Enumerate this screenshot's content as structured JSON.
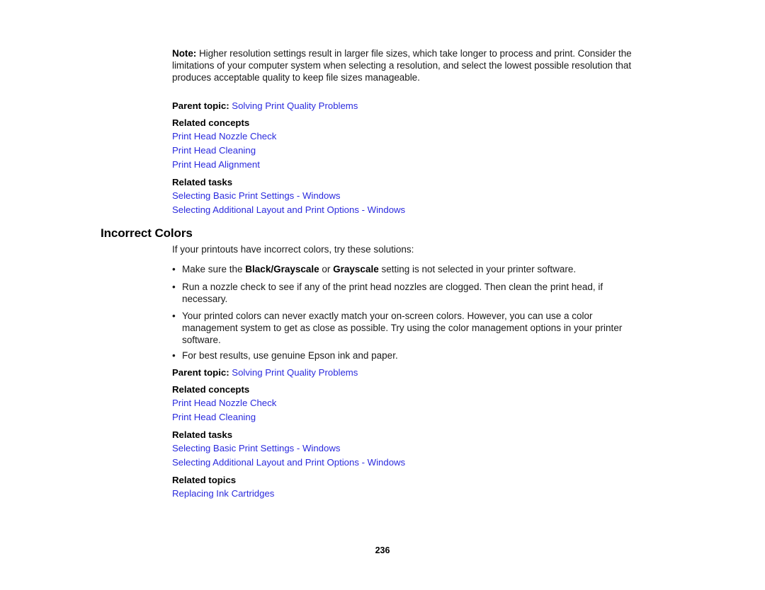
{
  "page": {
    "number": "236",
    "background": "#ffffff",
    "link_color": "#2b2bde",
    "text_color": "#1a1a1a"
  },
  "note": {
    "label": "Note:",
    "text": "Higher resolution settings result in larger file sizes, which take longer to process and print. Consider the limitations of your computer system when selecting a resolution, and select the lowest possible resolution that produces acceptable quality to keep file sizes manageable."
  },
  "related_block_top": {
    "parent_topic_label": "Parent topic:",
    "parent_topic_link": "Solving Print Quality Problems",
    "concepts_heading": "Related concepts",
    "concepts_links": [
      "Print Head Nozzle Check",
      "Print Head Cleaning",
      "Print Head Alignment"
    ],
    "tasks_heading": "Related tasks",
    "tasks_links": [
      "Selecting Basic Print Settings - Windows",
      "Selecting Additional Layout and Print Options - Windows"
    ]
  },
  "section": {
    "heading": "Incorrect Colors",
    "intro": "If your printouts have incorrect colors, try these solutions:",
    "bullet_marker": "•",
    "bullets": [
      {
        "parts": [
          {
            "text": "Make sure the ",
            "bold": false
          },
          {
            "text": "Black/Grayscale",
            "bold": true
          },
          {
            "text": " or ",
            "bold": false
          },
          {
            "text": "Grayscale",
            "bold": true
          },
          {
            "text": " setting is not selected in your printer software.",
            "bold": false
          }
        ]
      },
      {
        "parts": [
          {
            "text": "Run a nozzle check to see if any of the print head nozzles are clogged. Then clean the print head, if necessary.",
            "bold": false
          }
        ]
      },
      {
        "parts": [
          {
            "text": "Your printed colors can never exactly match your on-screen colors. However, you can use a color management system to get as close as possible. Try using the color management options in your printer software.",
            "bold": false
          }
        ]
      },
      {
        "parts": [
          {
            "text": "For best results, use genuine Epson ink and paper.",
            "bold": false
          }
        ]
      }
    ]
  },
  "related_block_bottom": {
    "parent_topic_label": "Parent topic:",
    "parent_topic_link": "Solving Print Quality Problems",
    "concepts_heading": "Related concepts",
    "concepts_links": [
      "Print Head Nozzle Check",
      "Print Head Cleaning"
    ],
    "tasks_heading": "Related tasks",
    "tasks_links": [
      "Selecting Basic Print Settings - Windows",
      "Selecting Additional Layout and Print Options - Windows"
    ],
    "topics_heading": "Related topics",
    "topics_links": [
      "Replacing Ink Cartridges"
    ]
  }
}
